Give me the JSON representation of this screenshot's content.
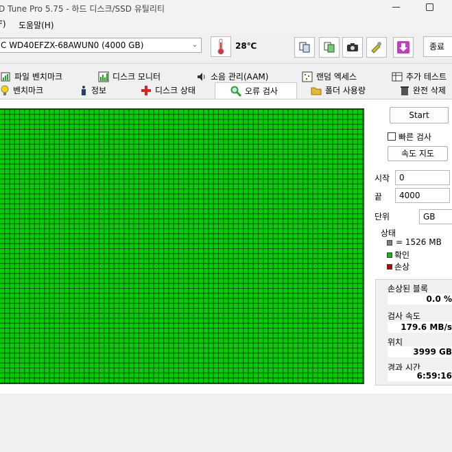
{
  "window": {
    "title": "D Tune Pro 5.75 - 하드 디스크/SSD 유틸리티"
  },
  "menu": {
    "items": [
      "F)",
      "도움말(H)"
    ]
  },
  "toolbar": {
    "drive": "C WD40EFZX-68AWUN0 (4000 GB)",
    "temperature": "28℃",
    "exit_label": "종료"
  },
  "tabs_row1": [
    {
      "label": "파일 벤치마크",
      "icon": "file-benchmark-icon"
    },
    {
      "label": "디스크 모니터",
      "icon": "disk-monitor-icon"
    },
    {
      "label": "소음 관리(AAM)",
      "icon": "speaker-icon"
    },
    {
      "label": "랜덤 엑세스",
      "icon": "random-access-icon"
    },
    {
      "label": "추가 테스트",
      "icon": "extra-tests-icon"
    }
  ],
  "tabs_row2": [
    {
      "label": "벤치마크",
      "icon": "benchmark-icon"
    },
    {
      "label": "정보",
      "icon": "info-icon"
    },
    {
      "label": "디스크 상태",
      "icon": "health-cross-icon"
    },
    {
      "label": "오류 검사",
      "icon": "magnifier-icon",
      "active": true
    },
    {
      "label": "폴더 사용량",
      "icon": "folder-icon"
    },
    {
      "label": "완전 삭제",
      "icon": "trash-icon"
    }
  ],
  "scan": {
    "start_label": "Start",
    "quick_scan_label": "빠른 검사",
    "quick_scan_checked": false,
    "speed_map_label": "속도 지도",
    "start_field_label": "시작",
    "start_value": "0",
    "end_field_label": "끝",
    "end_value": "4000",
    "unit_label": "단위",
    "unit_value": "GB"
  },
  "legend": {
    "title": "상태",
    "block_size": "= 1526 MB",
    "ok_label": "확인",
    "damaged_label": "손상",
    "colors": {
      "block": "#808080",
      "ok": "#00c000",
      "damaged": "#c00000"
    }
  },
  "stats": {
    "damaged_blocks_label": "손상된 블록",
    "damaged_blocks_value": "0.0 %",
    "scan_speed_label": "검사 속도",
    "scan_speed_value": "179.6 MB/s",
    "position_label": "위치",
    "position_value": "3999 GB",
    "elapsed_label": "경과 시간",
    "elapsed_value": "6:59:16"
  },
  "colors": {
    "grid_ok": "#00d000",
    "grid_lines": "#004000"
  }
}
